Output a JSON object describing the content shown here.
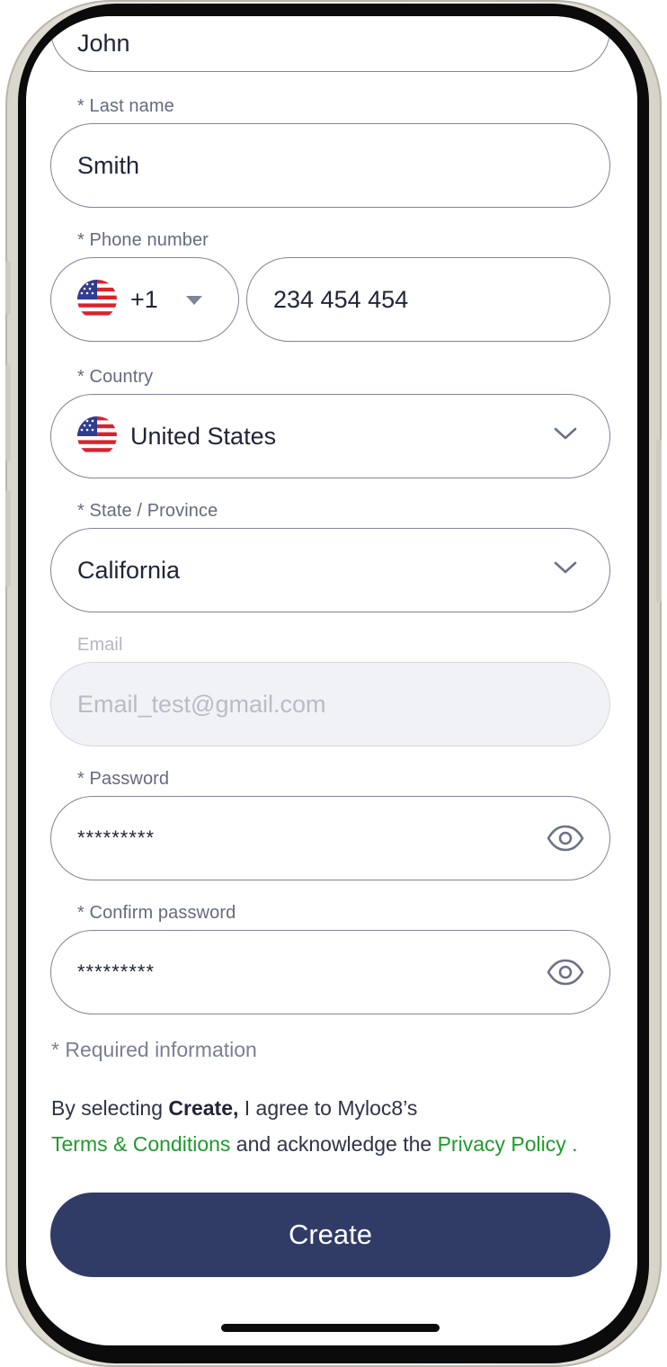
{
  "form": {
    "first_name_value": "John",
    "last_name": {
      "label": "* Last name",
      "value": "Smith"
    },
    "phone": {
      "label": "* Phone number",
      "country_code": "+1",
      "number": "234 454 454",
      "flag_icon": "us-flag-icon"
    },
    "country": {
      "label": "* Country",
      "value": "United States",
      "flag_icon": "us-flag-icon"
    },
    "state": {
      "label": "* State / Province",
      "value": "California"
    },
    "email": {
      "label": "Email",
      "value": "Email_test@gmail.com",
      "disabled": true
    },
    "password": {
      "label": "* Password",
      "value": "*********"
    },
    "confirm_password": {
      "label": "* Confirm password",
      "value": "*********"
    }
  },
  "required_note": "* Required information",
  "terms": {
    "prefix": "By selecting ",
    "create_word": "Create,",
    "middle": " I agree to Myloc8’s",
    "terms_link": "Terms & Conditions",
    "and_text": " and acknowledge the ",
    "privacy_link": "Privacy Policy ."
  },
  "create_button": "Create",
  "colors": {
    "primary_button": "#313c66",
    "link_green": "#1f9a2c",
    "field_border": "#7e859a",
    "label_gray": "#646b80"
  }
}
